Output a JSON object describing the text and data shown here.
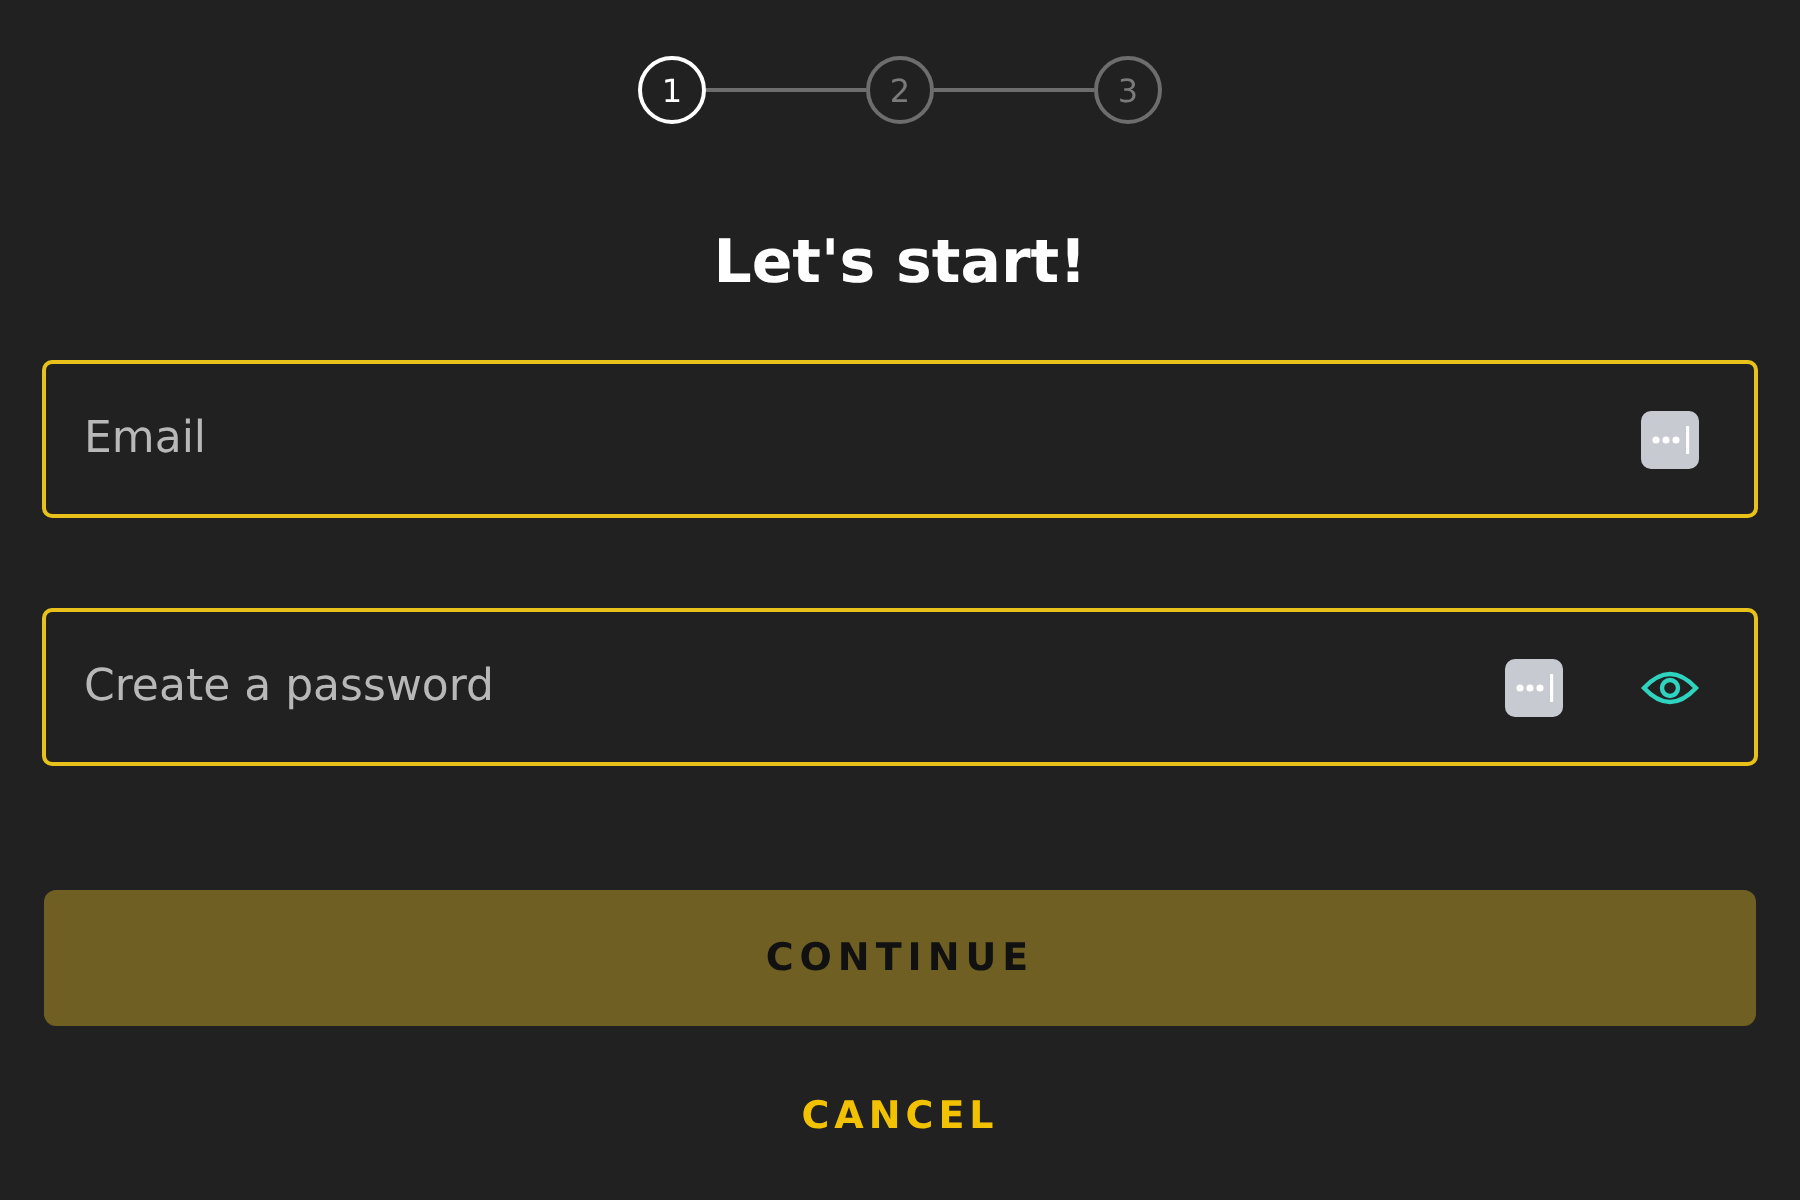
{
  "stepper": [
    {
      "label": "1",
      "selected": true
    },
    {
      "label": "2",
      "selected": false
    },
    {
      "label": "3",
      "selected": false
    }
  ],
  "title": "Let's start!",
  "fields": [
    {
      "kind": "email",
      "placeholder": "Email"
    },
    {
      "kind": "password",
      "placeholder": "Create a password"
    }
  ],
  "primary_button": "CONTINUE",
  "cancel_link": "CANCEL"
}
